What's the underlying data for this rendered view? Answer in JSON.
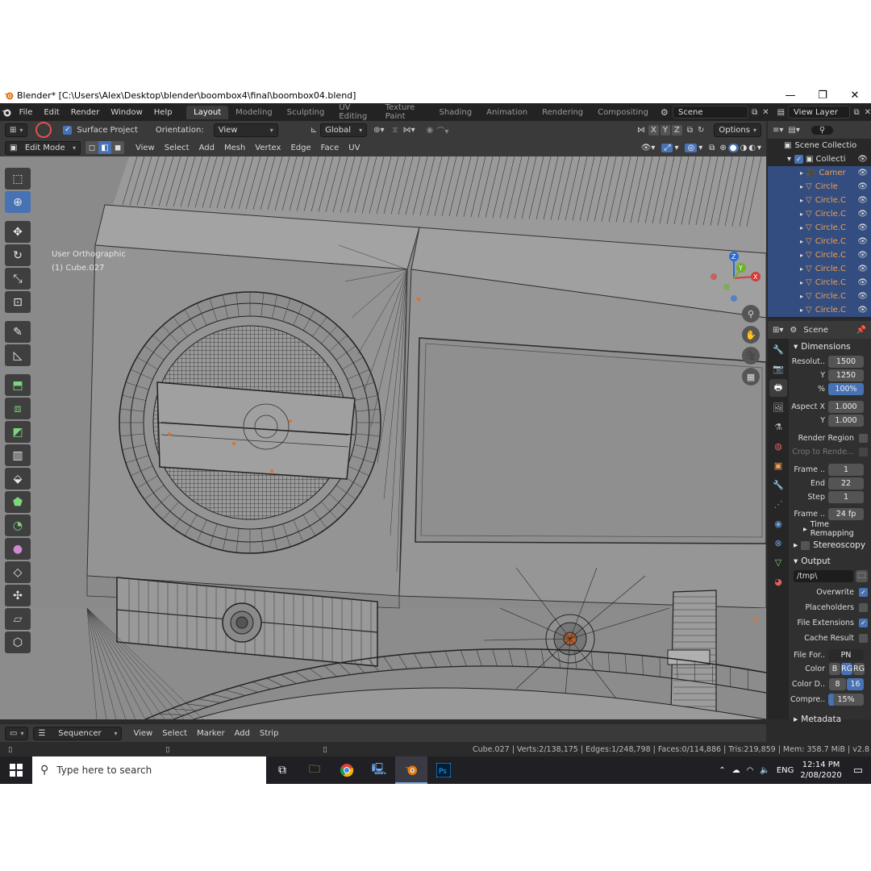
{
  "window": {
    "title": "Blender* [C:\\Users\\Alex\\Desktop\\blender\\boombox4\\final\\boombox04.blend]",
    "minimize": "—",
    "maximize": "❐",
    "close": "✕"
  },
  "menu": [
    "File",
    "Edit",
    "Render",
    "Window",
    "Help"
  ],
  "workspaces": [
    {
      "label": "Layout",
      "active": true
    },
    {
      "label": "Modeling",
      "active": false
    },
    {
      "label": "Sculpting",
      "active": false
    },
    {
      "label": "UV Editing",
      "active": false
    },
    {
      "label": "Texture Paint",
      "active": false
    },
    {
      "label": "Shading",
      "active": false
    },
    {
      "label": "Animation",
      "active": false
    },
    {
      "label": "Rendering",
      "active": false
    },
    {
      "label": "Compositing",
      "active": false
    }
  ],
  "scene_field": "Scene",
  "view_layer_field": "View Layer",
  "tool_header": {
    "surface_project": "Surface Project",
    "orientation_label": "Orientation:",
    "orientation_value": "View",
    "transform_orientation": "Global",
    "axes": [
      "X",
      "Y",
      "Z"
    ],
    "options": "Options"
  },
  "mode_header": {
    "mode": "Edit Mode",
    "menus": [
      "View",
      "Select",
      "Add",
      "Mesh",
      "Vertex",
      "Edge",
      "Face",
      "UV"
    ]
  },
  "viewport": {
    "view_name": "User Orthographic",
    "object_name": "(1) Cube.027",
    "gizmo_axes": [
      "X",
      "Y",
      "Z"
    ]
  },
  "outliner": {
    "root": "Scene Collectio",
    "collection": "Collecti",
    "items": [
      "Camer",
      "Circle",
      "Circle.C",
      "Circle.C",
      "Circle.C",
      "Circle.C",
      "Circle.C",
      "Circle.C",
      "Circle.C",
      "Circle.C",
      "Circle.C"
    ]
  },
  "properties": {
    "context": "Scene",
    "dimensions": {
      "title": "Dimensions",
      "resolution_x_label": "Resolut..",
      "resolution_x": "1500",
      "resolution_y_label": "Y",
      "resolution_y": "1250",
      "percent_label": "%",
      "percent": "100%",
      "aspect_x_label": "Aspect X",
      "aspect_x": "1.000",
      "aspect_y_label": "Y",
      "aspect_y": "1.000",
      "render_region": "Render Region",
      "crop": "Crop to Rende...",
      "frame_start_label": "Frame ..",
      "frame_start": "1",
      "frame_end_label": "End",
      "frame_end": "22",
      "step_label": "Step",
      "step": "1",
      "frame_rate_label": "Frame ..",
      "frame_rate": "24 fp",
      "time_remapping": "Time Remapping",
      "stereoscopy": "Stereoscopy"
    },
    "output": {
      "title": "Output",
      "path": "/tmp\\",
      "overwrite": "Overwrite",
      "placeholders": "Placeholders",
      "file_extensions": "File Extensions",
      "cache_result": "Cache Result",
      "file_format_label": "File For..",
      "file_format": "PN",
      "color_label": "Color",
      "color_options": [
        "B",
        "RG",
        "RG"
      ],
      "color_depth_label": "Color D..",
      "color_depth": [
        "8",
        "16"
      ],
      "compression_label": "Compre..",
      "compression": "15%",
      "metadata": "Metadata"
    }
  },
  "sequencer": {
    "editor": "Sequencer",
    "menus": [
      "View",
      "Select",
      "Marker",
      "Add",
      "Strip"
    ]
  },
  "status": {
    "stats": "Cube.027 | Verts:2/138,175 | Edges:1/248,798 | Faces:0/114,886 | Tris:219,859 | Mem: 358.7 MiB | v2.8"
  },
  "taskbar": {
    "search_placeholder": "Type here to search",
    "language": "ENG",
    "time": "12:14 PM",
    "date": "2/08/2020"
  },
  "colors": {
    "accent": "#4772b3",
    "selected_object": "#f0a050",
    "viewport_bg": "#8c8c8c"
  }
}
